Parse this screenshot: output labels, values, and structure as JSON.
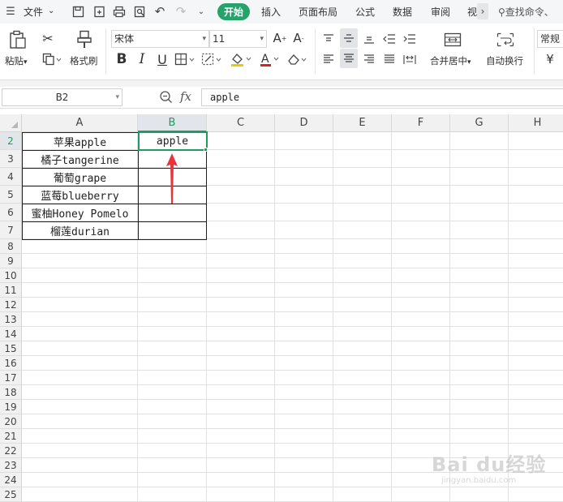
{
  "topbar": {
    "file_menu": "文件",
    "tabs": [
      "开始",
      "插入",
      "页面布局",
      "公式",
      "数据",
      "审阅",
      "视"
    ],
    "search_placeholder": "查找命令、"
  },
  "ribbon": {
    "paste_label": "粘贴",
    "format_painter_label": "格式刷",
    "font_name": "宋体",
    "font_size": "11",
    "merge_label": "合并居中",
    "wrap_label": "自动换行",
    "number_format": "常规",
    "currency_symbol": "¥"
  },
  "formula_bar": {
    "name_box": "B2",
    "fx_label": "fx",
    "value": "apple"
  },
  "sheet": {
    "columns": [
      "A",
      "B",
      "C",
      "D",
      "E",
      "F",
      "G",
      "H"
    ],
    "rows": [
      "2",
      "3",
      "4",
      "5",
      "6",
      "7",
      "8",
      "9",
      "10",
      "11",
      "12",
      "13",
      "14",
      "15",
      "16",
      "17",
      "18",
      "19",
      "20",
      "21",
      "22",
      "23",
      "24",
      "25"
    ],
    "active_column": "B",
    "active_row": "2",
    "column_a": [
      "苹果apple",
      "橘子tangerine",
      "葡萄grape",
      "蓝莓blueberry",
      "蜜柚Honey Pomelo",
      "榴莲durian"
    ],
    "column_b": [
      "apple",
      "",
      "",
      "",
      "",
      ""
    ]
  },
  "watermark": {
    "text": "Bai du经验",
    "subtext": "jingyan.baidu.com"
  },
  "colors": {
    "accent": "#1f9d61",
    "start_tab": "#26a26b",
    "arrow": "#e8343a"
  }
}
